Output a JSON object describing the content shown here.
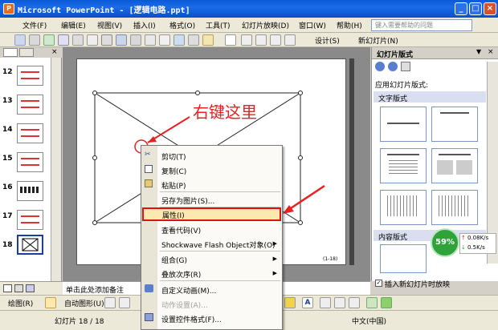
{
  "window": {
    "title": "Microsoft PowerPoint - [逻辑电路.ppt]",
    "app_icon": "P",
    "min": "_",
    "max": "□",
    "close": "×"
  },
  "menu": {
    "items": [
      "文件(F)",
      "编辑(E)",
      "视图(V)",
      "插入(I)",
      "格式(O)",
      "工具(T)",
      "幻灯片放映(D)",
      "窗口(W)",
      "帮助(H)"
    ],
    "help_placeholder": "键入需要帮助的问题"
  },
  "toolbar": {
    "design": "设计(S)",
    "new_slide": "新幻灯片(N)"
  },
  "slides_panel": {
    "numbers": [
      "12",
      "13",
      "14",
      "15",
      "16",
      "17",
      "18"
    ]
  },
  "slide": {
    "page_label": "(1-18)"
  },
  "annotation": {
    "text": "右键这里",
    "color": "#e82020"
  },
  "context_menu": {
    "items": [
      {
        "label": "剪切(T)",
        "icon": "scissors-icon"
      },
      {
        "label": "复制(C)",
        "icon": "copy-icon"
      },
      {
        "label": "粘贴(P)",
        "icon": "paste-icon"
      },
      {
        "label": "另存为图片(S)..."
      },
      {
        "label": "属性(I)"
      },
      {
        "label": "查看代码(V)"
      },
      {
        "label": "Shockwave Flash Object对象(O)"
      },
      {
        "label": "组合(G)"
      },
      {
        "label": "叠放次序(R)"
      },
      {
        "label": "自定义动画(M)...",
        "icon": "animation-icon"
      },
      {
        "label": "动作设置(A)..."
      },
      {
        "label": "设置控件格式(F)...",
        "icon": "format-icon"
      }
    ],
    "highlight_color": "#e01010"
  },
  "task_pane": {
    "title": "幻灯片版式",
    "apply_label": "应用幻灯片版式:",
    "section_text": "文字版式",
    "section_content": "内容版式",
    "show_on_insert": "插入新幻灯片时放映"
  },
  "notes": {
    "placeholder": "单击此处添加备注"
  },
  "drawbar": {
    "draw": "绘图(R)",
    "autoshape": "自动图形(U)"
  },
  "status": {
    "slide_info": "幻灯片 18 / 18",
    "language": "中文(中国)"
  },
  "net_widget": {
    "percent": "59%",
    "up": "0.08K/s",
    "down": "0.5K/s",
    "color": "#2fa33a"
  }
}
